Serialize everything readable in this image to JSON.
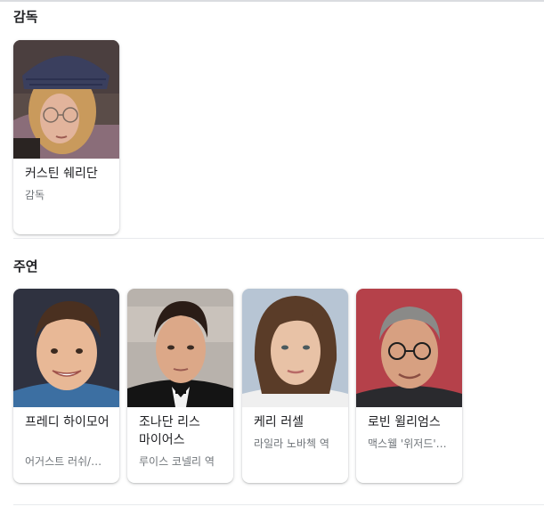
{
  "director_section": {
    "title": "감독",
    "people": [
      {
        "name": "커스틴 쉐리단",
        "role": "감독"
      }
    ]
  },
  "cast_section": {
    "title": "주연",
    "people": [
      {
        "name": "프레디 하이모어",
        "role": "어거스트 러쉬/…"
      },
      {
        "name": "조나단 리스 마이어스",
        "role": "루이스 코넬리 역"
      },
      {
        "name": "케리 러셀",
        "role": "라일라 노바첵 역"
      },
      {
        "name": "로빈 윌리엄스",
        "role": "맥스웰 '위저드'…"
      }
    ]
  }
}
